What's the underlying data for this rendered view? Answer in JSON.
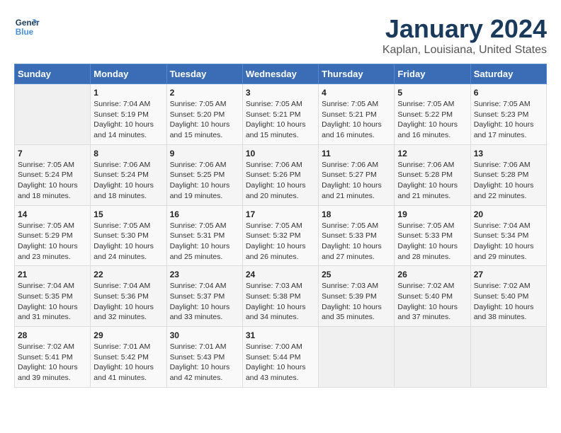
{
  "header": {
    "logo_general": "General",
    "logo_blue": "Blue",
    "title": "January 2024",
    "subtitle": "Kaplan, Louisiana, United States"
  },
  "calendar": {
    "days_of_week": [
      "Sunday",
      "Monday",
      "Tuesday",
      "Wednesday",
      "Thursday",
      "Friday",
      "Saturday"
    ],
    "weeks": [
      [
        {
          "num": "",
          "detail": ""
        },
        {
          "num": "1",
          "detail": "Sunrise: 7:04 AM\nSunset: 5:19 PM\nDaylight: 10 hours\nand 14 minutes."
        },
        {
          "num": "2",
          "detail": "Sunrise: 7:05 AM\nSunset: 5:20 PM\nDaylight: 10 hours\nand 15 minutes."
        },
        {
          "num": "3",
          "detail": "Sunrise: 7:05 AM\nSunset: 5:21 PM\nDaylight: 10 hours\nand 15 minutes."
        },
        {
          "num": "4",
          "detail": "Sunrise: 7:05 AM\nSunset: 5:21 PM\nDaylight: 10 hours\nand 16 minutes."
        },
        {
          "num": "5",
          "detail": "Sunrise: 7:05 AM\nSunset: 5:22 PM\nDaylight: 10 hours\nand 16 minutes."
        },
        {
          "num": "6",
          "detail": "Sunrise: 7:05 AM\nSunset: 5:23 PM\nDaylight: 10 hours\nand 17 minutes."
        }
      ],
      [
        {
          "num": "7",
          "detail": "Sunrise: 7:05 AM\nSunset: 5:24 PM\nDaylight: 10 hours\nand 18 minutes."
        },
        {
          "num": "8",
          "detail": "Sunrise: 7:06 AM\nSunset: 5:24 PM\nDaylight: 10 hours\nand 18 minutes."
        },
        {
          "num": "9",
          "detail": "Sunrise: 7:06 AM\nSunset: 5:25 PM\nDaylight: 10 hours\nand 19 minutes."
        },
        {
          "num": "10",
          "detail": "Sunrise: 7:06 AM\nSunset: 5:26 PM\nDaylight: 10 hours\nand 20 minutes."
        },
        {
          "num": "11",
          "detail": "Sunrise: 7:06 AM\nSunset: 5:27 PM\nDaylight: 10 hours\nand 21 minutes."
        },
        {
          "num": "12",
          "detail": "Sunrise: 7:06 AM\nSunset: 5:28 PM\nDaylight: 10 hours\nand 21 minutes."
        },
        {
          "num": "13",
          "detail": "Sunrise: 7:06 AM\nSunset: 5:28 PM\nDaylight: 10 hours\nand 22 minutes."
        }
      ],
      [
        {
          "num": "14",
          "detail": "Sunrise: 7:05 AM\nSunset: 5:29 PM\nDaylight: 10 hours\nand 23 minutes."
        },
        {
          "num": "15",
          "detail": "Sunrise: 7:05 AM\nSunset: 5:30 PM\nDaylight: 10 hours\nand 24 minutes."
        },
        {
          "num": "16",
          "detail": "Sunrise: 7:05 AM\nSunset: 5:31 PM\nDaylight: 10 hours\nand 25 minutes."
        },
        {
          "num": "17",
          "detail": "Sunrise: 7:05 AM\nSunset: 5:32 PM\nDaylight: 10 hours\nand 26 minutes."
        },
        {
          "num": "18",
          "detail": "Sunrise: 7:05 AM\nSunset: 5:33 PM\nDaylight: 10 hours\nand 27 minutes."
        },
        {
          "num": "19",
          "detail": "Sunrise: 7:05 AM\nSunset: 5:33 PM\nDaylight: 10 hours\nand 28 minutes."
        },
        {
          "num": "20",
          "detail": "Sunrise: 7:04 AM\nSunset: 5:34 PM\nDaylight: 10 hours\nand 29 minutes."
        }
      ],
      [
        {
          "num": "21",
          "detail": "Sunrise: 7:04 AM\nSunset: 5:35 PM\nDaylight: 10 hours\nand 31 minutes."
        },
        {
          "num": "22",
          "detail": "Sunrise: 7:04 AM\nSunset: 5:36 PM\nDaylight: 10 hours\nand 32 minutes."
        },
        {
          "num": "23",
          "detail": "Sunrise: 7:04 AM\nSunset: 5:37 PM\nDaylight: 10 hours\nand 33 minutes."
        },
        {
          "num": "24",
          "detail": "Sunrise: 7:03 AM\nSunset: 5:38 PM\nDaylight: 10 hours\nand 34 minutes."
        },
        {
          "num": "25",
          "detail": "Sunrise: 7:03 AM\nSunset: 5:39 PM\nDaylight: 10 hours\nand 35 minutes."
        },
        {
          "num": "26",
          "detail": "Sunrise: 7:02 AM\nSunset: 5:40 PM\nDaylight: 10 hours\nand 37 minutes."
        },
        {
          "num": "27",
          "detail": "Sunrise: 7:02 AM\nSunset: 5:40 PM\nDaylight: 10 hours\nand 38 minutes."
        }
      ],
      [
        {
          "num": "28",
          "detail": "Sunrise: 7:02 AM\nSunset: 5:41 PM\nDaylight: 10 hours\nand 39 minutes."
        },
        {
          "num": "29",
          "detail": "Sunrise: 7:01 AM\nSunset: 5:42 PM\nDaylight: 10 hours\nand 41 minutes."
        },
        {
          "num": "30",
          "detail": "Sunrise: 7:01 AM\nSunset: 5:43 PM\nDaylight: 10 hours\nand 42 minutes."
        },
        {
          "num": "31",
          "detail": "Sunrise: 7:00 AM\nSunset: 5:44 PM\nDaylight: 10 hours\nand 43 minutes."
        },
        {
          "num": "",
          "detail": ""
        },
        {
          "num": "",
          "detail": ""
        },
        {
          "num": "",
          "detail": ""
        }
      ]
    ]
  }
}
